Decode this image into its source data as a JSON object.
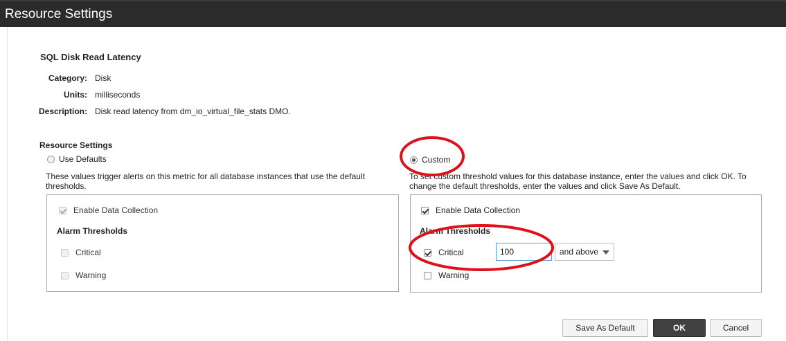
{
  "window": {
    "title": "Resource Settings"
  },
  "metric": {
    "name": "SQL Disk Read Latency",
    "category_label": "Category:",
    "category": "Disk",
    "units_label": "Units:",
    "units": "milliseconds",
    "description_label": "Description:",
    "description": "Disk read latency from dm_io_virtual_file_stats DMO."
  },
  "settings": {
    "section_label": "Resource Settings",
    "use_defaults": {
      "label": "Use Defaults",
      "selected": false,
      "help_line1": "These values trigger alerts on this metric for all database instances that use the default",
      "help_line2": "thresholds.",
      "enable_collection_label": "Enable Data Collection",
      "alarm_thresholds_label": "Alarm Thresholds",
      "critical_label": "Critical",
      "warning_label": "Warning"
    },
    "custom": {
      "label": "Custom",
      "selected": true,
      "help_line1": "To set custom threshold values for this database instance, enter the values and click OK. To",
      "help_line2": "change the default thresholds, enter the values and click Save As Default.",
      "enable_collection_label": "Enable Data Collection",
      "alarm_thresholds_label": "Alarm Thresholds",
      "critical_label": "Critical",
      "critical_value": "100",
      "condition": "and above",
      "warning_label": "Warning"
    }
  },
  "buttons": {
    "save_default": "Save As Default",
    "ok": "OK",
    "cancel": "Cancel"
  },
  "colors": {
    "annotation": "#e0101a",
    "titlebar": "#2b2b2b"
  }
}
